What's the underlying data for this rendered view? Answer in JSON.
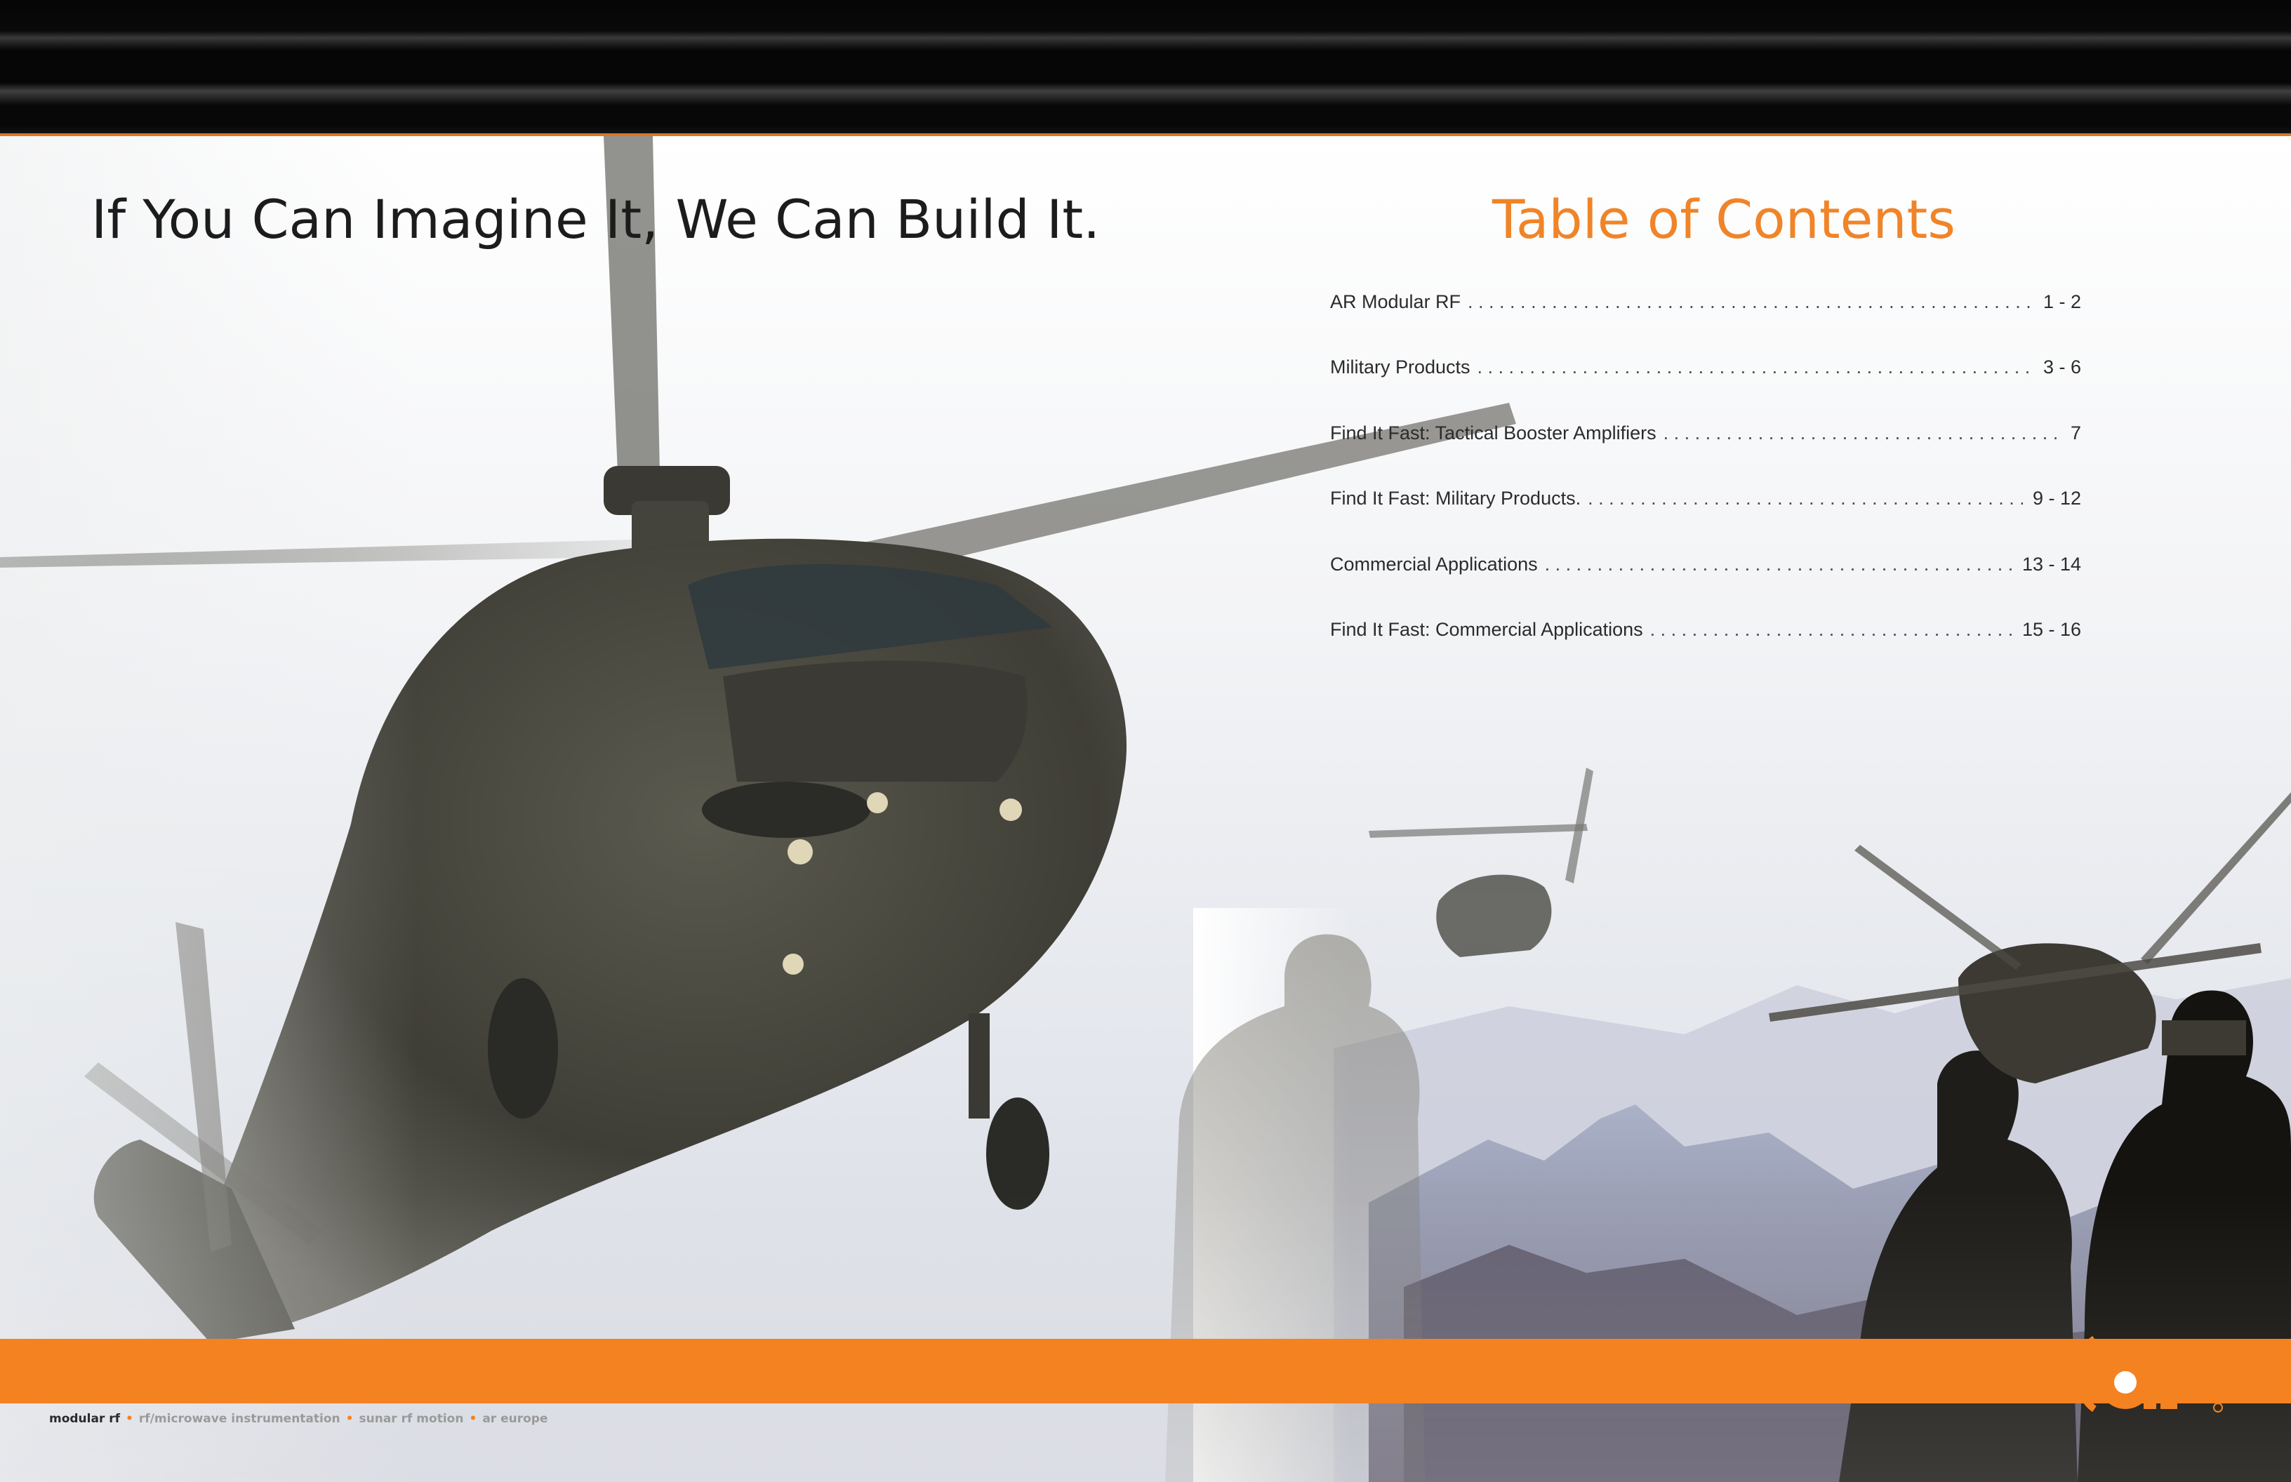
{
  "left_page": {
    "headline": "If You Can Imagine It, We Can Build It."
  },
  "right_page": {
    "toc_title": "Table of Contents",
    "entries": [
      {
        "label": "AR Modular RF",
        "pages": "1 - 2"
      },
      {
        "label": "Military Products",
        "pages": "3 - 6"
      },
      {
        "label": "Find It Fast: Tactical Booster Amplifiers",
        "pages": "7"
      },
      {
        "label": "Find It Fast: Military Products.",
        "pages": "9 - 12"
      },
      {
        "label": "Commercial Applications",
        "pages": "13 - 14"
      },
      {
        "label": "Find It Fast: Commercial Applications",
        "pages": "15 - 16"
      }
    ]
  },
  "footer": {
    "divisions": [
      "modular rf",
      "rf/microwave instrumentation",
      "sunar rf motion",
      "ar europe"
    ],
    "separator": "•"
  },
  "logo": {
    "text": "ar"
  },
  "colors": {
    "accent_orange": "#f58220",
    "toc_title_orange": "#f08428",
    "banner_black": "#0a0a0a",
    "text_dark": "#1c1c1c"
  }
}
